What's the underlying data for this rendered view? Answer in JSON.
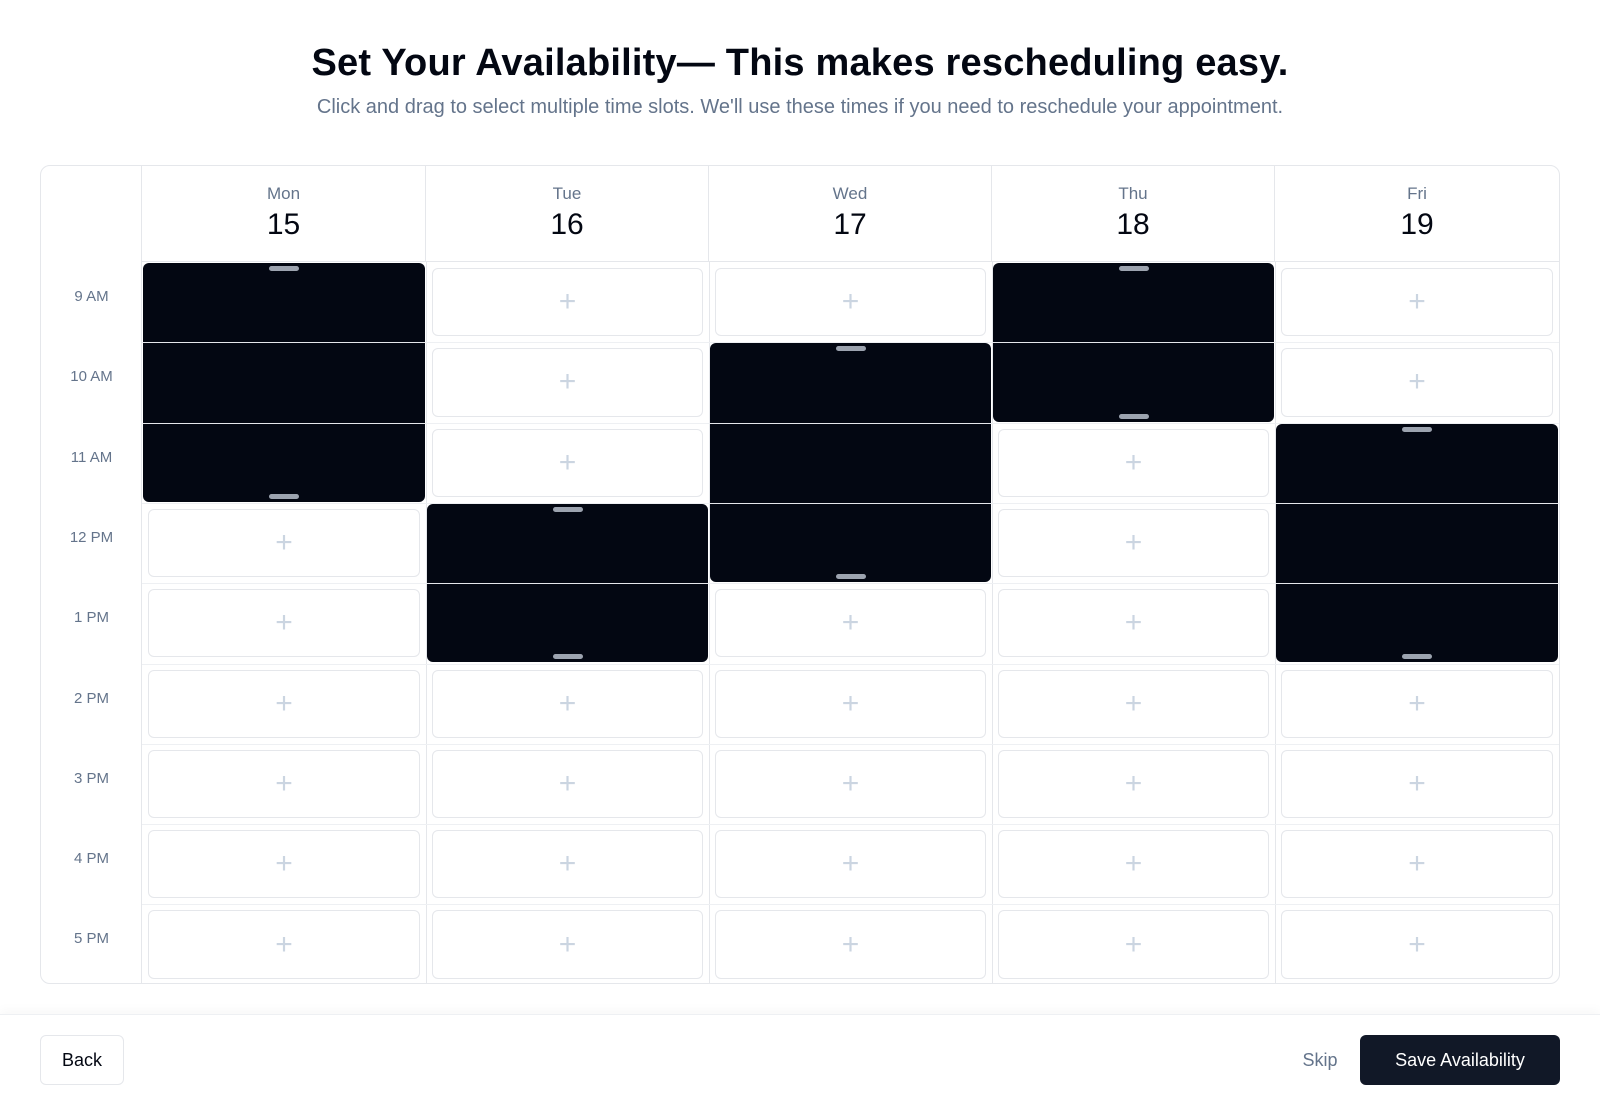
{
  "header": {
    "title": "Set Your Availability— This makes rescheduling easy.",
    "subtitle": "Click and drag to select multiple time slots. We'll use these times if you need to reschedule your appointment."
  },
  "calendar": {
    "days": [
      {
        "name": "Mon",
        "date": "15"
      },
      {
        "name": "Tue",
        "date": "16"
      },
      {
        "name": "Wed",
        "date": "17"
      },
      {
        "name": "Thu",
        "date": "18"
      },
      {
        "name": "Fri",
        "date": "19"
      }
    ],
    "times": [
      "9 AM",
      "10 AM",
      "11 AM",
      "12 PM",
      "1 PM",
      "2 PM",
      "3 PM",
      "4 PM",
      "5 PM"
    ],
    "add_icon": "plus-icon",
    "selected_ranges": [
      {
        "day": "Mon",
        "start": "9 AM",
        "end": "11 AM"
      },
      {
        "day": "Tue",
        "start": "12 PM",
        "end": "1 PM"
      },
      {
        "day": "Wed",
        "start": "10 AM",
        "end": "12 PM"
      },
      {
        "day": "Thu",
        "start": "9 AM",
        "end": "10 AM"
      },
      {
        "day": "Fri",
        "start": "11 AM",
        "end": "1 PM"
      }
    ],
    "selected_color": "#030712",
    "empty_icon_color": "#cbd5e1"
  },
  "footer": {
    "back_label": "Back",
    "skip_label": "Skip",
    "save_label": "Save Availability"
  }
}
